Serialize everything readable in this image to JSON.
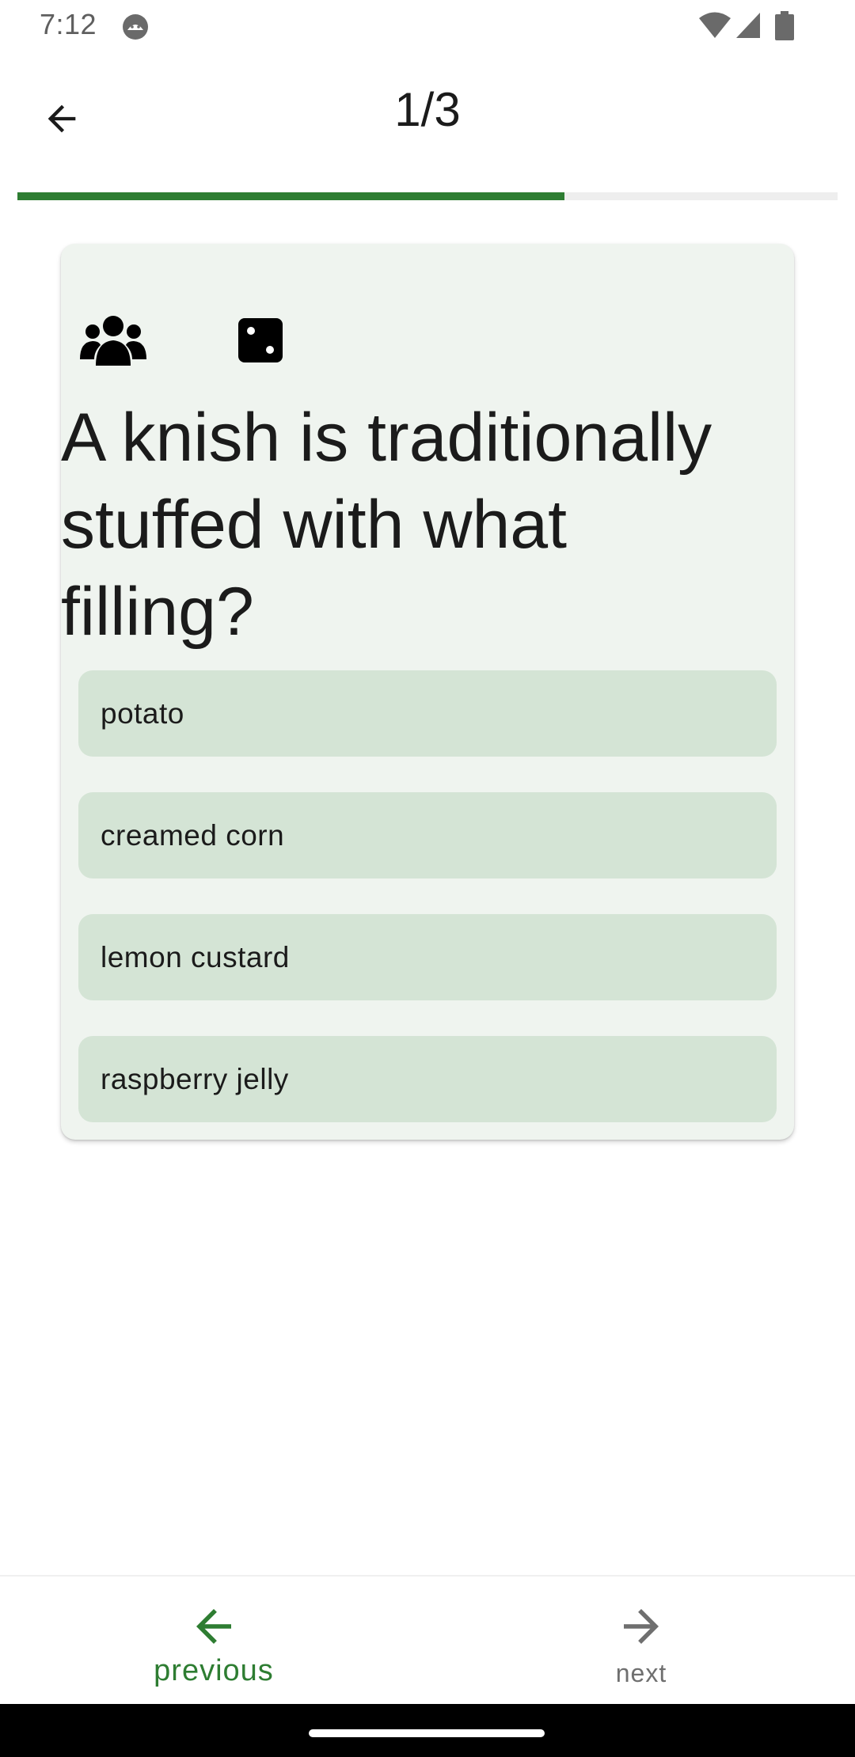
{
  "status_bar": {
    "time": "7:12",
    "app_icon": "android-debug-icon",
    "wifi_icon": "wifi-icon",
    "signal_icon": "cell-signal-icon",
    "battery_icon": "battery-icon"
  },
  "app_bar": {
    "back_icon": "arrow-back-icon",
    "title": "1/3"
  },
  "progress": {
    "fraction": 0.667,
    "color": "#2e7d32",
    "track_color": "#eeeeee"
  },
  "question": {
    "category_icon": "group-icon",
    "difficulty_icon": "dice-one-icon",
    "text": "A knish is traditionally stuffed with what filling?",
    "answers": [
      {
        "label": "potato"
      },
      {
        "label": "creamed corn"
      },
      {
        "label": "lemon custard"
      },
      {
        "label": "raspberry jelly"
      }
    ]
  },
  "bottom_nav": {
    "previous": {
      "label": "previous",
      "icon": "arrow-left-icon",
      "color": "#2e7d32"
    },
    "next": {
      "label": "next",
      "icon": "arrow-right-icon",
      "color": "#6f6f6f"
    }
  }
}
